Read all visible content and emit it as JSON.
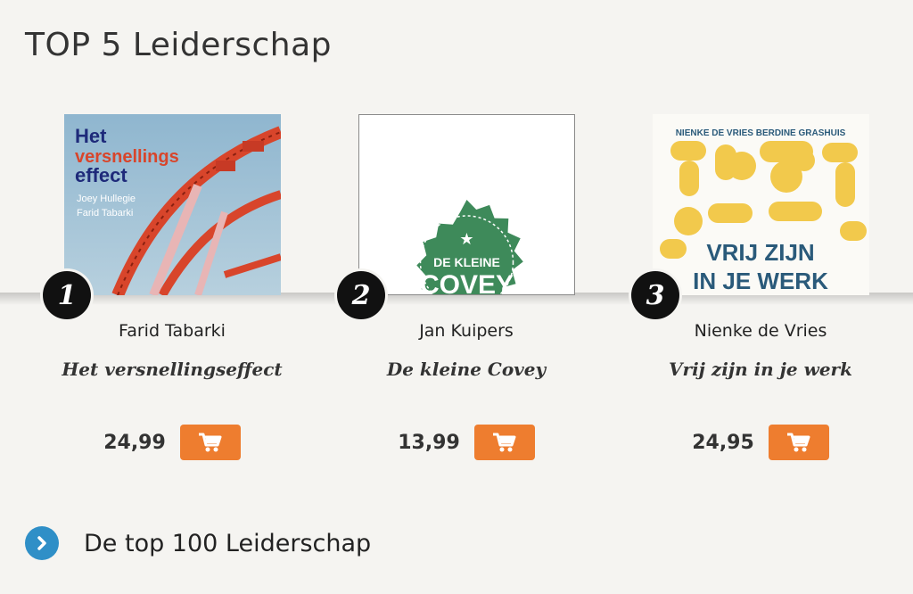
{
  "section": {
    "title": "TOP 5 Leiderschap"
  },
  "products": [
    {
      "rank": "1",
      "author": "Farid Tabarki",
      "title": "Het versnellingseffect",
      "price": "24,99",
      "cover": {
        "line1": "Het",
        "line2": "versnellings",
        "line3": "effect",
        "author1": "Joey Hullegie",
        "author2": "Farid Tabarki"
      }
    },
    {
      "rank": "2",
      "author": "Jan Kuipers",
      "title": "De kleine Covey",
      "price": "13,99",
      "cover": {
        "line1": "DE KLEINE",
        "line2": "COVEY"
      }
    },
    {
      "rank": "3",
      "author": "Nienke de Vries",
      "title": "Vrij zijn in je werk",
      "price": "24,95",
      "cover": {
        "authors": "NIENKE DE VRIES   BERDINE GRASHUIS",
        "line1": "VRIJ ZIJN",
        "line2": "IN JE WERK"
      }
    }
  ],
  "more": {
    "label": "De top 100 Leiderschap"
  },
  "icons": {
    "cart": "shopping-cart-icon",
    "chevron": "chevron-right-icon"
  },
  "colors": {
    "accent": "#ee7d2f",
    "link_icon": "#2f8fc7",
    "background": "#f5f4f1"
  }
}
